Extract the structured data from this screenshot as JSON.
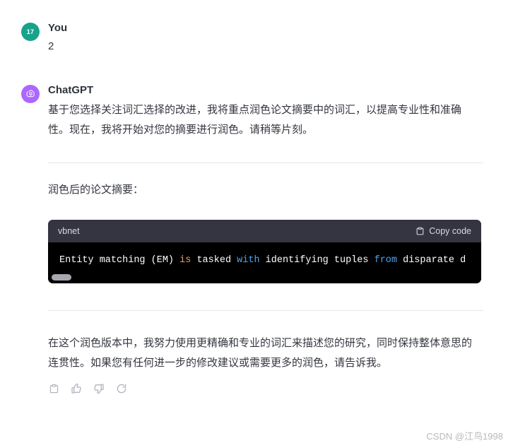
{
  "messages": {
    "user": {
      "avatar_label": "17",
      "author": "You",
      "content": "2"
    },
    "assistant": {
      "author": "ChatGPT",
      "paragraph_1": "基于您选择关注词汇选择的改进，我将重点润色论文摘要中的词汇，以提高专业性和准确性。现在，我将开始对您的摘要进行润色。请稍等片刻。",
      "section_label": "润色后的论文摘要：",
      "paragraph_2": "在这个润色版本中，我努力使用更精确和专业的词汇来描述您的研究，同时保持整体意思的连贯性。如果您有任何进一步的修改建议或需要更多的润色，请告诉我。"
    }
  },
  "code_block": {
    "language": "vbnet",
    "copy_label": "Copy code",
    "copy_icon": "clipboard-icon",
    "tokens": [
      {
        "text": "Entity matching (EM) ",
        "type": "plain"
      },
      {
        "text": "is",
        "type": "keyword-orange"
      },
      {
        "text": " tasked ",
        "type": "plain"
      },
      {
        "text": "with",
        "type": "keyword-blue"
      },
      {
        "text": " identifying tuples ",
        "type": "plain"
      },
      {
        "text": "from",
        "type": "keyword-blue"
      },
      {
        "text": " disparate d",
        "type": "plain"
      }
    ],
    "full_line": "Entity matching (EM) is tasked with identifying tuples from disparate d"
  },
  "action_bar": {
    "buttons": [
      {
        "name": "copy-icon",
        "title": "Copy"
      },
      {
        "name": "thumbs-up-icon",
        "title": "Good response"
      },
      {
        "name": "thumbs-down-icon",
        "title": "Bad response"
      },
      {
        "name": "regenerate-icon",
        "title": "Regenerate"
      }
    ]
  },
  "watermark": "CSDN @江鸟1998",
  "colors": {
    "user_avatar": "#19a28b",
    "assistant_avatar": "#ab68ff",
    "code_header_bg": "#343541",
    "code_body_bg": "#000000",
    "keyword_orange": "#e2a564",
    "keyword_blue": "#4aa5f0",
    "divider": "#e6e6e6",
    "text": "#353740"
  }
}
